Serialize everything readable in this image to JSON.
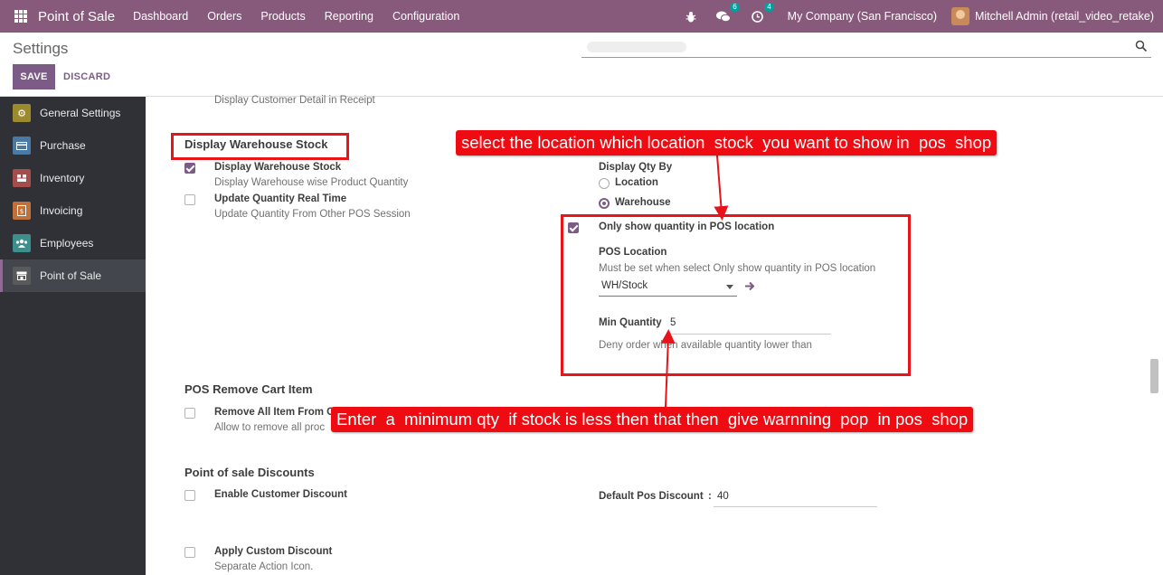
{
  "navbar": {
    "brand": "Point of Sale",
    "menu": [
      "Dashboard",
      "Orders",
      "Products",
      "Reporting",
      "Configuration"
    ],
    "chat_count": "6",
    "activity_count": "4",
    "company": "My Company (San Francisco)",
    "user": "Mitchell Admin (retail_video_retake)"
  },
  "control": {
    "title": "Settings",
    "save_label": "SAVE",
    "discard_label": "DISCARD"
  },
  "sidebar": {
    "items": [
      {
        "label": "General Settings",
        "color": "#9c8b2c"
      },
      {
        "label": "Purchase",
        "color": "#4a7aa3"
      },
      {
        "label": "Inventory",
        "color": "#a34d4d"
      },
      {
        "label": "Invoicing",
        "color": "#c0703a"
      },
      {
        "label": "Employees",
        "color": "#3c8f8b"
      },
      {
        "label": "Point of Sale",
        "color": "#5a5a5a"
      }
    ]
  },
  "main": {
    "receipt_desc": "Display Customer Detail in Receipt",
    "warehouse_section": "Display Warehouse Stock",
    "display_stock_label": "Display Warehouse Stock",
    "display_stock_desc": "Display Warehouse wise Product Quantity",
    "update_qty_label": "Update Quantity Real Time",
    "update_qty_desc": "Update Quantity From Other POS Session",
    "qty_by_label": "Display Qty By",
    "opt_location": "Location",
    "opt_warehouse": "Warehouse",
    "only_show_label": "Only show quantity in POS location",
    "pos_location_label": "POS Location",
    "pos_location_desc": "Must be set when select Only show quantity in POS location",
    "pos_location_value": "WH/Stock",
    "min_qty_label": "Min Quantity",
    "min_qty_value": "5",
    "min_qty_desc": "Deny order when available quantity lower than",
    "remove_section": "POS Remove Cart Item",
    "remove_all_label": "Remove All Item From C",
    "remove_all_desc": "Allow to remove all proc",
    "discount_section": "Point of sale Discounts",
    "enable_discount_label": "Enable Customer Discount",
    "default_discount_label": "Default Pos Discount",
    "default_discount_sep": ":",
    "default_discount_value": "40",
    "custom_discount_label": "Apply Custom Discount",
    "custom_discount_desc": "Separate Action Icon."
  },
  "annotations": {
    "callout_top": "select the location which location  stock  you want to show in  pos  shop",
    "callout_bottom": "Enter  a  minimum qty  if stock is less then that then  give warnning  pop  in pos  shop"
  },
  "colors": {
    "navbar": "#875a7b",
    "primary": "#7c5c86",
    "annotation": "#ef0b12"
  }
}
